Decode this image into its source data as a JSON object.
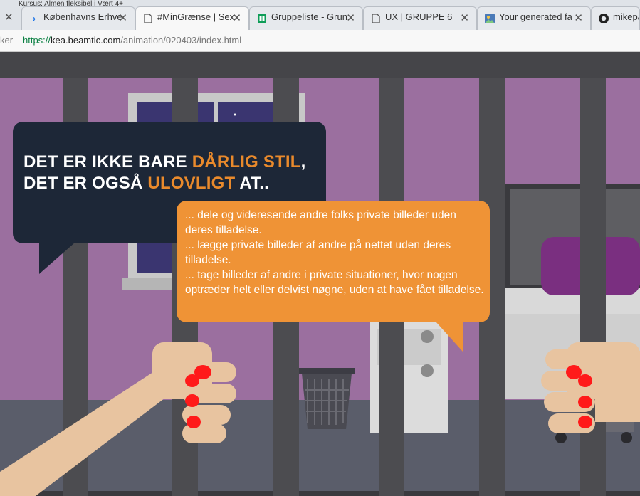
{
  "browser": {
    "partial_tab_text": "Kursus: Almen  fleksibel i Vært 4+",
    "tabs": [
      {
        "title": "Københavns Erhve",
        "icon": "chevron-right-icon",
        "icon_color": "#1a73e8",
        "active": false
      },
      {
        "title": "#MinGrænse | Sex",
        "icon": "page-icon",
        "icon_color": "#555555",
        "active": true
      },
      {
        "title": "Gruppeliste - Grun",
        "icon": "sheets-icon",
        "icon_color": "#0f9d58",
        "active": false
      },
      {
        "title": "UX | GRUPPE 6",
        "icon": "page-icon",
        "icon_color": "#555555",
        "active": false
      },
      {
        "title": "Your generated fa",
        "icon": "image-icon",
        "icon_color": "#4a7ab8",
        "active": false
      },
      {
        "title": "mikepa",
        "icon": "github-icon",
        "icon_color": "#222222",
        "active": false
      }
    ],
    "close_glyph": "✕",
    "address": {
      "left_fragment": "ker",
      "scheme": "https://",
      "domain": "kea.beamtic.com",
      "path": "/animation/020403/index.html"
    }
  },
  "scene": {
    "colors": {
      "wall": "#9b6f9f",
      "bars": "#4c4c50",
      "floor": "#5a5d6a",
      "dark_bubble": "#1d2737",
      "orange": "#ef9336",
      "skin": "#e8c4a0",
      "nails": "#ff1a1a"
    },
    "headline": {
      "line1_prefix": "DET ER IKKE BARE ",
      "line1_highlight": "DÅRLIG STIL",
      "line1_suffix": ",",
      "line2_prefix": "DET ER OGSÅ ",
      "line2_highlight": "ULOVLIGT",
      "line2_suffix": " AT.."
    },
    "points": [
      "... dele og videresende andre folks private billeder uden deres tilladelse.",
      "... lægge private billeder af andre på nettet uden deres tilladelse.",
      "... tage billeder af andre i private situationer, hvor nogen optræder helt eller delvist nøgne, uden at have fået tilladelse."
    ]
  }
}
